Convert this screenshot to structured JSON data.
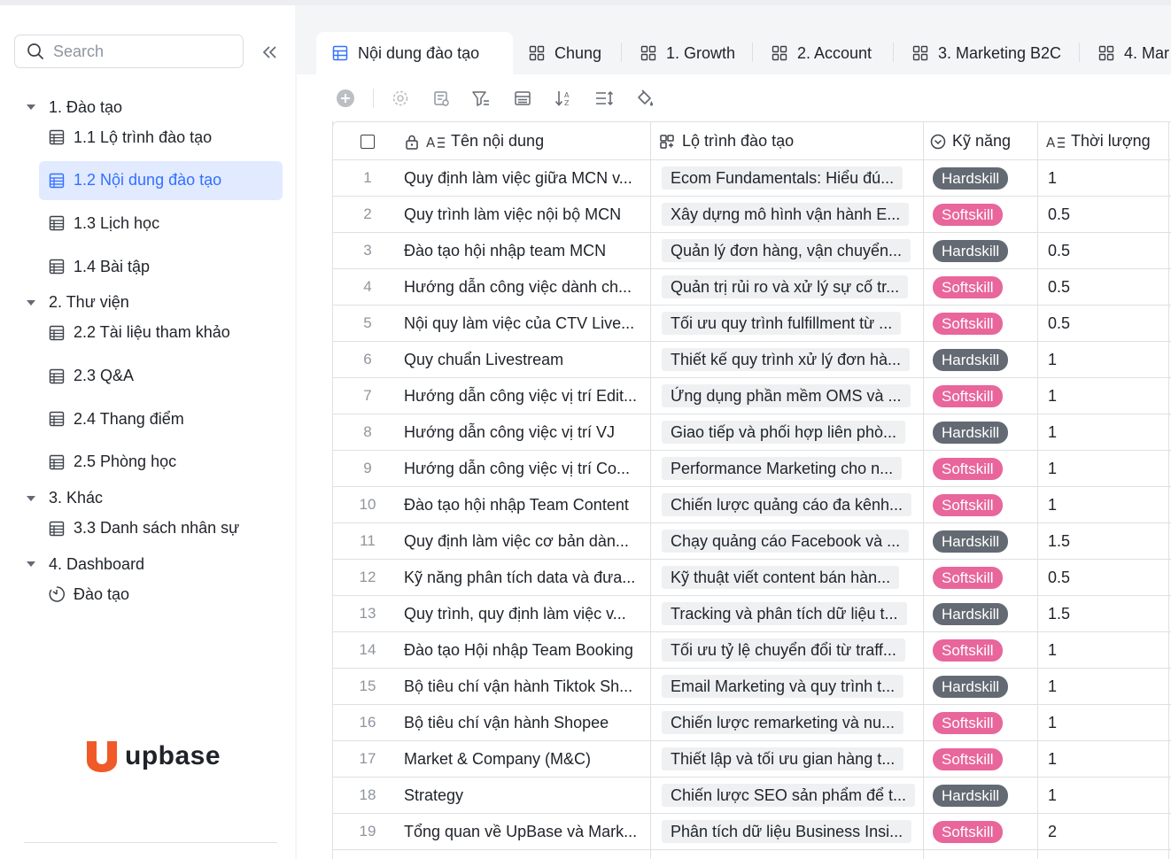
{
  "sidebar": {
    "search_placeholder": "Search",
    "groups": [
      {
        "label": "1. Đào tạo",
        "items": [
          {
            "label": "1.1 Lộ trình đào tạo",
            "icon": "table-icon"
          },
          {
            "label": "1.2 Nội dung đào tạo",
            "icon": "table-icon",
            "active": true
          },
          {
            "label": "1.3 Lịch học",
            "icon": "table-icon"
          },
          {
            "label": "1.4 Bài tập",
            "icon": "table-icon"
          }
        ]
      },
      {
        "label": "2. Thư viện",
        "items": [
          {
            "label": "2.2 Tài liệu tham khảo",
            "icon": "table-icon"
          },
          {
            "label": "2.3 Q&A",
            "icon": "table-icon"
          },
          {
            "label": "2.4 Thang điểm",
            "icon": "table-icon"
          },
          {
            "label": "2.5 Phòng học",
            "icon": "table-icon"
          }
        ]
      },
      {
        "label": "3. Khác",
        "items": [
          {
            "label": "3.3 Danh sách nhân sự",
            "icon": "table-icon"
          }
        ]
      },
      {
        "label": "4. Dashboard",
        "items": [
          {
            "label": "Đào tạo",
            "icon": "dashboard-gauge-icon"
          }
        ]
      }
    ],
    "logo_text": "upbase"
  },
  "tabs": [
    {
      "label": "Nội dung đào tạo",
      "icon": "grid-table-icon",
      "active": true
    },
    {
      "label": "Chung",
      "icon": "board-view-icon"
    },
    {
      "label": "1. Growth",
      "icon": "board-view-icon"
    },
    {
      "label": "2. Account",
      "icon": "board-view-icon"
    },
    {
      "label": "3. Marketing B2C",
      "icon": "board-view-icon"
    },
    {
      "label": "4. Mar",
      "icon": "board-view-icon"
    }
  ],
  "columns": {
    "name": "Tên nội dung",
    "path": "Lộ trình đào tạo",
    "skill": "Kỹ năng",
    "duration": "Thời lượng"
  },
  "colors": {
    "accent": "#3370ff",
    "hardskill": "#646a73",
    "softskill": "#e8669b",
    "logo": "#f05a28"
  },
  "rows": [
    {
      "n": "1",
      "name": "Quy định làm việc giữa MCN v...",
      "path": "Ecom Fundamentals: Hiểu đú...",
      "skill": "Hardskill",
      "dur": "1"
    },
    {
      "n": "2",
      "name": "Quy trình làm việc nội bộ MCN",
      "path": "Xây dựng mô hình vận hành E...",
      "skill": "Softskill",
      "dur": "0.5"
    },
    {
      "n": "3",
      "name": "Đào tạo hội nhập team MCN",
      "path": "Quản lý đơn hàng, vận chuyển...",
      "skill": "Hardskill",
      "dur": "0.5"
    },
    {
      "n": "4",
      "name": "Hướng dẫn công việc dành ch...",
      "path": "Quản trị rủi ro và xử lý sự cố tr...",
      "skill": "Softskill",
      "dur": "0.5"
    },
    {
      "n": "5",
      "name": "Nội quy làm việc của CTV Live...",
      "path": "Tối ưu quy trình fulfillment từ ...",
      "skill": "Softskill",
      "dur": "0.5"
    },
    {
      "n": "6",
      "name": "Quy chuẩn Livestream",
      "path": "Thiết kế quy trình xử lý đơn hà...",
      "skill": "Hardskill",
      "dur": "1"
    },
    {
      "n": "7",
      "name": "Hướng dẫn công việc vị trí Edit...",
      "path": "Ứng dụng phần mềm OMS và ...",
      "skill": "Softskill",
      "dur": "1"
    },
    {
      "n": "8",
      "name": "Hướng dẫn công việc vị trí VJ",
      "path": "Giao tiếp và phối hợp liên phò...",
      "skill": "Hardskill",
      "dur": "1"
    },
    {
      "n": "9",
      "name": "Hướng dẫn công việc vị trí Co...",
      "path": "Performance Marketing cho n...",
      "skill": "Softskill",
      "dur": "1"
    },
    {
      "n": "10",
      "name": "Đào tạo hội nhập Team Content",
      "path": "Chiến lược quảng cáo đa kênh...",
      "skill": "Softskill",
      "dur": "1"
    },
    {
      "n": "11",
      "name": "Quy định làm việc cơ bản dàn...",
      "path": "Chạy quảng cáo Facebook và ...",
      "skill": "Hardskill",
      "dur": "1.5"
    },
    {
      "n": "12",
      "name": "Kỹ năng phân tích data và đưa...",
      "path": "Kỹ thuật viết content bán hàn...",
      "skill": "Softskill",
      "dur": "0.5"
    },
    {
      "n": "13",
      "name": "Quy trình, quy định làm việc v...",
      "path": "Tracking và phân tích dữ liệu t...",
      "skill": "Hardskill",
      "dur": "1.5"
    },
    {
      "n": "14",
      "name": "Đào tạo Hội nhập Team Booking",
      "path": "Tối ưu tỷ lệ chuyển đổi từ traff...",
      "skill": "Softskill",
      "dur": "1"
    },
    {
      "n": "15",
      "name": "Bộ tiêu chí vận hành Tiktok Sh...",
      "path": "Email Marketing và quy trình t...",
      "skill": "Hardskill",
      "dur": "1"
    },
    {
      "n": "16",
      "name": "Bộ tiêu chí vận hành Shopee",
      "path": "Chiến lược remarketing và nu...",
      "skill": "Softskill",
      "dur": "1"
    },
    {
      "n": "17",
      "name": "Market & Company (M&C)",
      "path": "Thiết lập và tối ưu gian hàng t...",
      "skill": "Softskill",
      "dur": "1"
    },
    {
      "n": "18",
      "name": "Strategy",
      "path": "Chiến lược SEO sản phẩm để t...",
      "skill": "Hardskill",
      "dur": "1"
    },
    {
      "n": "19",
      "name": "Tổng quan về UpBase và Mark...",
      "path": "Phân tích dữ liệu Business Insi...",
      "skill": "Softskill",
      "dur": "2"
    }
  ]
}
